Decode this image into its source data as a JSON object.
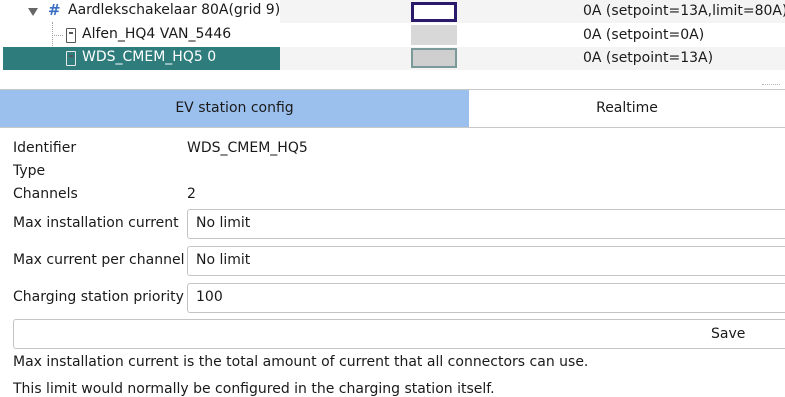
{
  "tree": {
    "rows": [
      {
        "label": "Aardlekschakelaar 80A(grid 9)",
        "status": "0A (setpoint=13A,limit=80A)",
        "swatch_border": "#2b1a6b",
        "swatch_fill": "#ffffff"
      },
      {
        "label": "Alfen_HQ4 VAN_5446",
        "status": "0A (setpoint=0A)",
        "swatch_fill": "#d8d8d8"
      },
      {
        "label": "WDS_CMEM_HQ5 0",
        "status": "0A (setpoint=13A)",
        "swatch_fill": "#cfcfcf",
        "selected": true
      }
    ],
    "selection_color": "#2e7d7c",
    "group_icon": "#"
  },
  "tabs": {
    "config": "EV station config",
    "realtime": "Realtime",
    "active_color": "#9cc0ee"
  },
  "form": {
    "identifier_label": "Identifier",
    "identifier_value": "WDS_CMEM_HQ5",
    "type_label": "Type",
    "type_value": "",
    "channels_label": "Channels",
    "channels_value": "2",
    "max_install_label": "Max installation current",
    "max_install_value": "No limit",
    "max_channel_label": "Max current per channel",
    "max_channel_value": "No limit",
    "priority_label": "Charging station priority",
    "priority_value": "100",
    "save_label": "Save"
  },
  "help": {
    "line1": "Max installation current is the total amount of current that all connectors can use.",
    "line2": "This limit would normally be configured in the charging station itself."
  }
}
